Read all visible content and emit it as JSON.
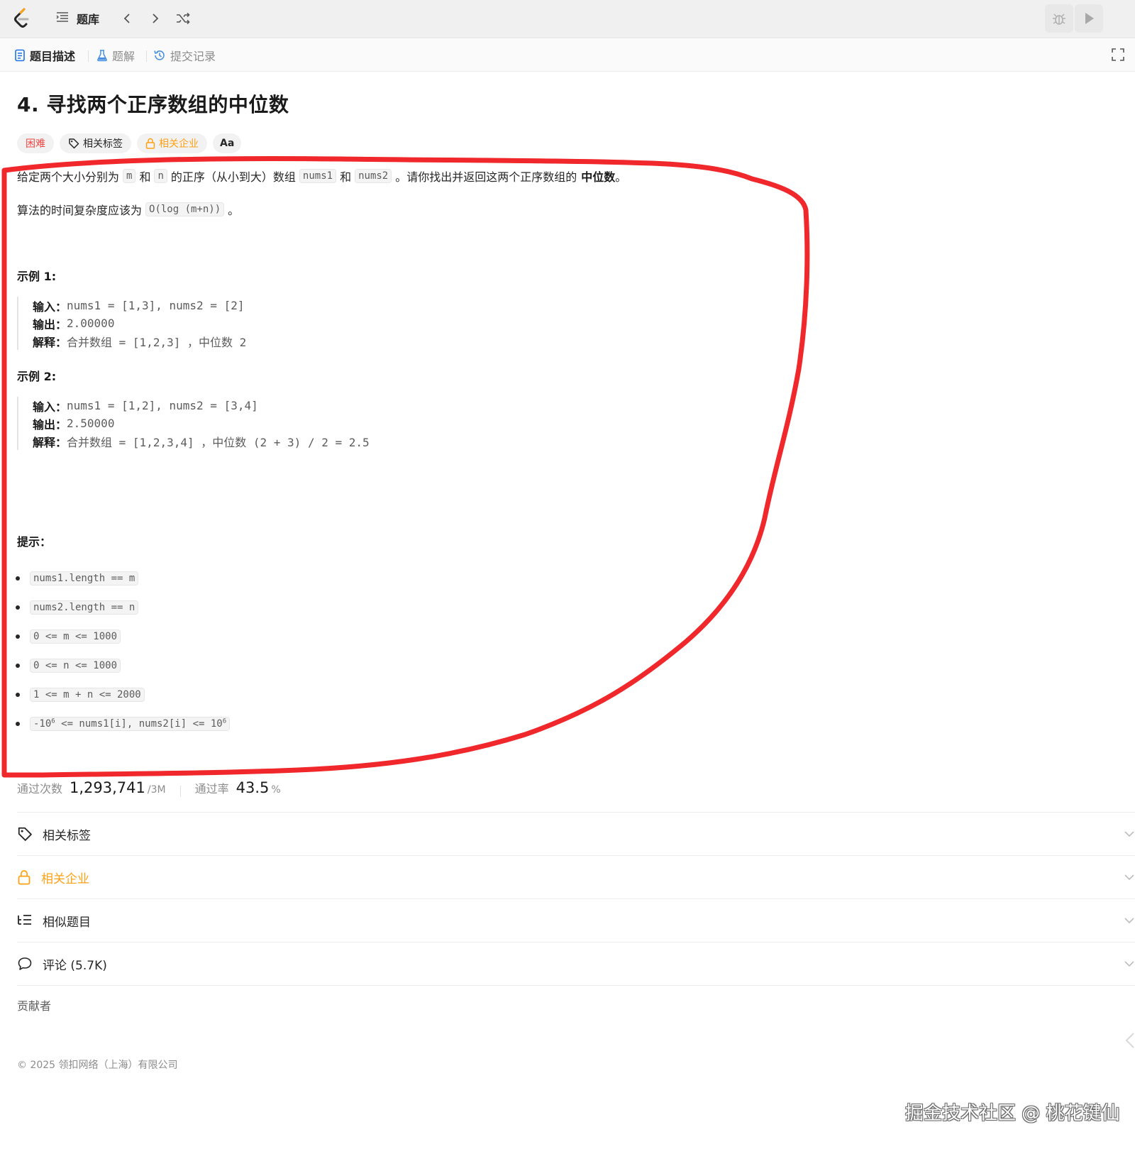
{
  "topbar": {
    "problem_list_label": "题库"
  },
  "tabs": [
    {
      "label": "题目描述"
    },
    {
      "label": "题解"
    },
    {
      "label": "提交记录"
    }
  ],
  "problem": {
    "title": "4. 寻找两个正序数组的中位数",
    "difficulty": "困难",
    "tags_badge": "相关标签",
    "company_badge": "相关企业",
    "font_badge": "Aa"
  },
  "description": {
    "p1_a": "给定两个大小分别为",
    "p1_m": "m",
    "p1_b": "和",
    "p1_n": "n",
    "p1_c": "的正序（从小到大）数组",
    "p1_nums1": "nums1",
    "p1_d": "和",
    "p1_nums2": "nums2",
    "p1_e": "。请你找出并返回这两个正序数组的",
    "p1_strong": "中位数",
    "p1_f": "。",
    "p2_a": "算法的时间复杂度应该为",
    "p2_code": "O(log (m+n))",
    "p2_b": "。"
  },
  "examples": [
    {
      "heading": "示例 1:",
      "input_label": "输入：",
      "input": "nums1 = [1,3], nums2 = [2]",
      "output_label": "输出：",
      "output": "2.00000",
      "explain_label": "解释：",
      "explain": "合并数组 = [1,2,3] ，中位数 2"
    },
    {
      "heading": "示例 2:",
      "input_label": "输入：",
      "input": "nums1 = [1,2], nums2 = [3,4]",
      "output_label": "输出：",
      "output": "2.50000",
      "explain_label": "解释：",
      "explain": "合并数组 = [1,2,3,4] ，中位数 (2 + 3) / 2 = 2.5"
    }
  ],
  "hints": {
    "heading": "提示：",
    "items": [
      "nums1.length == m",
      "nums2.length == n",
      "0 <= m <= 1000",
      "0 <= n <= 1000",
      "1 <= m + n <= 2000"
    ],
    "last_a": "-10",
    "last_sup1": "6",
    "last_b": " <= nums1[i], nums2[i] <= 10",
    "last_sup2": "6"
  },
  "stats": {
    "accepted_label": "通过次数",
    "accepted_value": "1,293,741",
    "accepted_total": "/3M",
    "rate_label": "通过率",
    "rate_value": "43.5",
    "rate_unit": "%"
  },
  "sections": [
    {
      "label": "相关标签"
    },
    {
      "label": "相关企业"
    },
    {
      "label": "相似题目"
    },
    {
      "label": "评论 (5.7K)"
    }
  ],
  "contributors_label": "贡献者",
  "copyright": "© 2025 领扣网络（上海）有限公司",
  "watermark": "掘金技术社区 @ 桃花键仙",
  "colors": {
    "accent_orange": "#ffa116",
    "hard_red": "#ef4743",
    "annotation_red": "#f0272b",
    "tab_blue": "#1a73e8"
  }
}
